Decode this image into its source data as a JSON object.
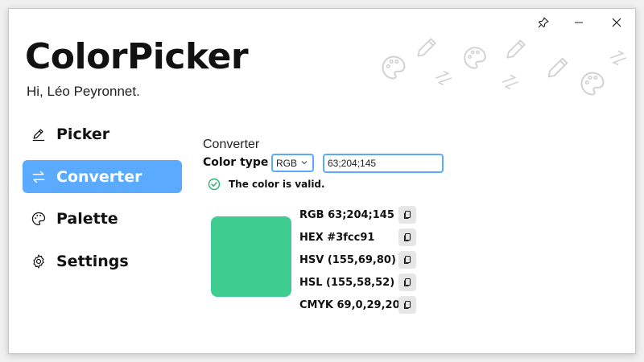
{
  "app": {
    "title": "ColorPicker",
    "greeting": "Hi, Léo Peyronnet."
  },
  "window_controls": {
    "pin_icon": "pin-icon",
    "minimize_icon": "minimize-icon",
    "close_icon": "close-icon"
  },
  "nav": {
    "items": [
      {
        "label": "Picker",
        "icon": "pen-icon",
        "active": false
      },
      {
        "label": "Converter",
        "icon": "swap-arrows-icon",
        "active": true
      },
      {
        "label": "Palette",
        "icon": "palette-icon",
        "active": false
      },
      {
        "label": "Settings",
        "icon": "gear-icon",
        "active": false
      }
    ]
  },
  "converter": {
    "section_title": "Converter",
    "color_type_label": "Color type",
    "color_type_value": "RGB",
    "input_value": "63;204;145",
    "valid_message": "The color is valid.",
    "swatch_color": "#3fcc91",
    "values": [
      {
        "text": "RGB 63;204;145"
      },
      {
        "text": "HEX #3fcc91"
      },
      {
        "text": "HSV (155,69,80)"
      },
      {
        "text": "HSL (155,58,52)"
      },
      {
        "text": "CMYK 69,0,29,20"
      }
    ]
  },
  "colors": {
    "accent": "#5aabff",
    "valid_green": "#3fcc91"
  }
}
